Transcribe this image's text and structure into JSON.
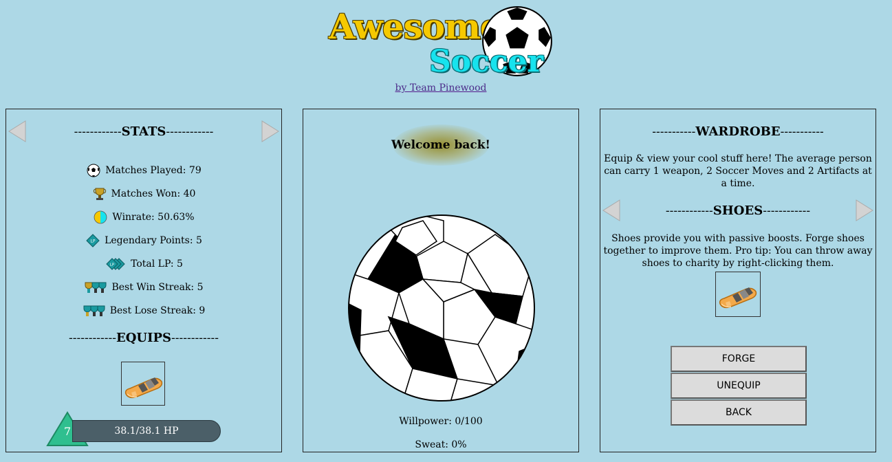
{
  "header": {
    "logo_word1": "Awesome",
    "logo_word2": "Soccer",
    "byline": "by Team Pinewood"
  },
  "stats": {
    "title_prefix": "------------",
    "title": "STATS",
    "title_suffix": "------------",
    "rows": [
      {
        "icon": "soccer-ball-icon",
        "label": "Matches Played: 79"
      },
      {
        "icon": "trophy-icon",
        "label": "Matches Won: 40"
      },
      {
        "icon": "winrate-circle-icon",
        "label": "Winrate: 50.63%"
      },
      {
        "icon": "legendary-points-icon",
        "label": "Legendary Points: 5"
      },
      {
        "icon": "total-lp-icon",
        "label": "Total LP: 5"
      },
      {
        "icon": "win-streak-icon",
        "label": "Best Win Streak: 5"
      },
      {
        "icon": "lose-streak-icon",
        "label": "Best Lose Streak: 9"
      }
    ],
    "equips_prefix": "------------",
    "equips_title": "EQUIPS",
    "equips_suffix": "------------",
    "level": "7",
    "hp": "38.1/38.1 HP"
  },
  "center": {
    "welcome": "Welcome back!",
    "willpower": "Willpower: 0/100",
    "sweat": "Sweat: 0%"
  },
  "wardrobe": {
    "title_prefix": "-----------",
    "title": "WARDROBE",
    "title_suffix": "-----------",
    "description": "Equip & view your cool stuff here! The average person can carry 1 weapon, 2 Soccer Moves and 2 Artifacts at a time.",
    "shoes_prefix": "------------",
    "shoes_title": "SHOES",
    "shoes_suffix": "------------",
    "shoes_description": "Shoes provide you with passive boosts. Forge shoes together to improve them. Pro tip: You can throw away shoes to charity by right-clicking them.",
    "buttons": {
      "forge": "FORGE",
      "unequip": "UNEQUIP",
      "back": "BACK"
    }
  },
  "colors": {
    "background": "#add8e6",
    "logo_yellow": "#f6c900",
    "logo_cyan": "#17e3ee",
    "hp_bar": "#4b5f68",
    "level_badge": "#2fbf8f",
    "button": "#dcdcdc"
  }
}
